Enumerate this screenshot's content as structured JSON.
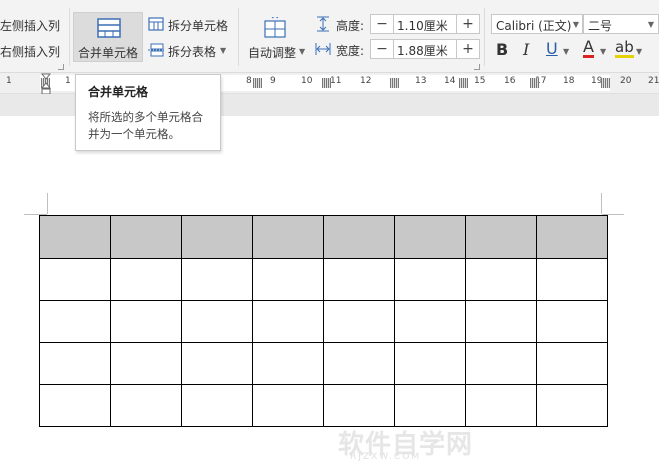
{
  "ribbon": {
    "insert_left": "左侧插入列",
    "insert_right": "右侧插入列",
    "merge_cells": "合并单元格",
    "split_cells": "拆分单元格",
    "split_table": "拆分表格",
    "auto_fit": "自动调整",
    "height_label": "高度:",
    "height_value": "1.10厘米",
    "width_label": "宽度:",
    "width_value": "1.88厘米",
    "font_name": "Calibri (正文)",
    "font_size": "二号",
    "bold": "B",
    "italic": "I",
    "underline": "U",
    "font_color": "A",
    "highlight": "ab",
    "minus": "−",
    "plus": "+"
  },
  "ruler": {
    "numbers": [
      "1",
      "1",
      "8",
      "9",
      "10",
      "11",
      "12",
      "13",
      "14",
      "15",
      "16",
      "17",
      "18",
      "19",
      "20",
      "21"
    ]
  },
  "tooltip": {
    "title": "合并单元格",
    "description": "将所选的多个单元格合并为一个单元格。"
  },
  "table": {
    "rows": 5,
    "cols": 8,
    "header_color": "#c8c8c8"
  },
  "watermark": {
    "main": "软件自学网",
    "sub": "RJZXW.COM"
  }
}
